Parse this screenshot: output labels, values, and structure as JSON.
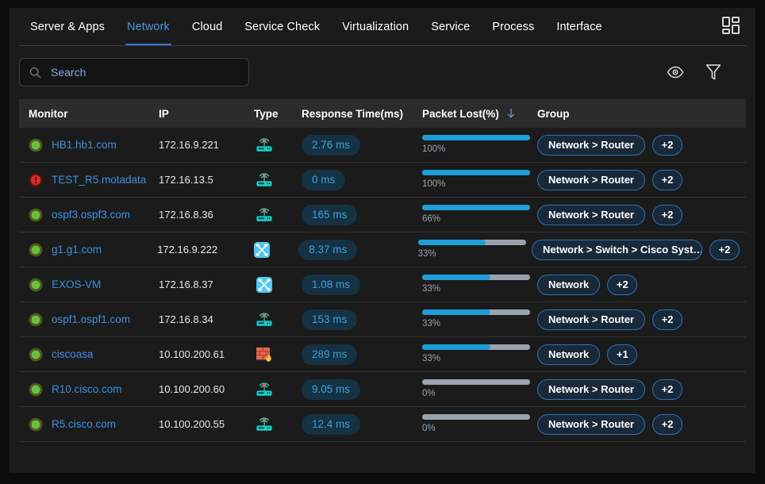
{
  "nav": {
    "tabs": [
      {
        "label": "Server & Apps",
        "active": false
      },
      {
        "label": "Network",
        "active": true
      },
      {
        "label": "Cloud",
        "active": false
      },
      {
        "label": "Service Check",
        "active": false
      },
      {
        "label": "Virtualization",
        "active": false
      },
      {
        "label": "Service",
        "active": false
      },
      {
        "label": "Process",
        "active": false
      },
      {
        "label": "Interface",
        "active": false
      }
    ],
    "dashboard_icon": "dashboard-grid-icon",
    "active_color": "#4d94e0",
    "active_underline_color": "#2e7cd6"
  },
  "toolbar": {
    "search": {
      "placeholder": "Search",
      "value": "",
      "icon": "search-icon"
    },
    "eye_icon": "eye-icon",
    "filter_icon": "filter-funnel-icon"
  },
  "table": {
    "columns": [
      {
        "key": "monitor",
        "label": "Monitor"
      },
      {
        "key": "ip",
        "label": "IP"
      },
      {
        "key": "type",
        "label": "Type"
      },
      {
        "key": "response",
        "label": "Response Time(ms)"
      },
      {
        "key": "packet",
        "label": "Packet Lost(%)",
        "sorted": true,
        "sort_direction": "desc",
        "sort_icon": "arrow-down-icon"
      },
      {
        "key": "group",
        "label": "Group"
      }
    ],
    "rows": [
      {
        "status": "ok",
        "status_icon": "status-ok-icon",
        "monitor": "HB1.hb1.com",
        "ip": "172.16.9.221",
        "type_icon": "router-icon",
        "response": "2.76 ms",
        "packet_pct": 100,
        "packet_label": "100%",
        "bar_fill_pct": 100,
        "group": "Network > Router",
        "group_more": "+2"
      },
      {
        "status": "critical",
        "status_icon": "status-critical-icon",
        "monitor": "TEST_R5.motadata",
        "ip": "172.16.13.5",
        "type_icon": "router-icon",
        "response": "0 ms",
        "packet_pct": 100,
        "packet_label": "100%",
        "bar_fill_pct": 100,
        "group": "Network > Router",
        "group_more": "+2"
      },
      {
        "status": "ok",
        "status_icon": "status-ok-icon",
        "monitor": "ospf3.ospf3.com",
        "ip": "172.16.8.36",
        "type_icon": "router-icon",
        "response": "165 ms",
        "packet_pct": 66,
        "packet_label": "66%",
        "bar_fill_pct": 100,
        "group": "Network > Router",
        "group_more": "+2"
      },
      {
        "status": "ok",
        "status_icon": "status-ok-icon",
        "monitor": "g1.g1.com",
        "ip": "172.16.9.222",
        "type_icon": "switch-icon",
        "response": "8.37 ms",
        "packet_pct": 33,
        "packet_label": "33%",
        "bar_fill_pct": 63,
        "group": "Network > Switch > Cisco Syst…",
        "group_more": "+2"
      },
      {
        "status": "ok",
        "status_icon": "status-ok-icon",
        "monitor": "EXOS-VM",
        "ip": "172.16.8.37",
        "type_icon": "switch-icon",
        "response": "1.08 ms",
        "packet_pct": 33,
        "packet_label": "33%",
        "bar_fill_pct": 63,
        "group": "Network",
        "group_more": "+2"
      },
      {
        "status": "ok",
        "status_icon": "status-ok-icon",
        "monitor": "ospf1.ospf1.com",
        "ip": "172.16.8.34",
        "type_icon": "router-icon",
        "response": "153 ms",
        "packet_pct": 33,
        "packet_label": "33%",
        "bar_fill_pct": 63,
        "group": "Network > Router",
        "group_more": "+2"
      },
      {
        "status": "ok",
        "status_icon": "status-ok-icon",
        "monitor": "ciscoasa",
        "ip": "10.100.200.61",
        "type_icon": "firewall-icon",
        "response": "289 ms",
        "packet_pct": 33,
        "packet_label": "33%",
        "bar_fill_pct": 63,
        "group": "Network",
        "group_more": "+1"
      },
      {
        "status": "ok",
        "status_icon": "status-ok-icon",
        "monitor": "R10.cisco.com",
        "ip": "10.100.200.60",
        "type_icon": "router-icon",
        "response": "9.05 ms",
        "packet_pct": 0,
        "packet_label": "0%",
        "bar_fill_pct": 0,
        "group": "Network > Router",
        "group_more": "+2"
      },
      {
        "status": "ok",
        "status_icon": "status-ok-icon",
        "monitor": "R5.cisco.com",
        "ip": "10.100.200.55",
        "type_icon": "router-icon",
        "response": "12.4 ms",
        "packet_pct": 0,
        "packet_label": "0%",
        "bar_fill_pct": 0,
        "group": "Network > Router",
        "group_more": "+2"
      }
    ]
  },
  "colors": {
    "page_background": "#0c0c0c",
    "panel_background": "#1b1b1b",
    "header_row": "#2b2b2b",
    "row_divider": "#333333",
    "link_blue": "#3d8fe0",
    "pill_blue_text": "#3d9fd8",
    "pill_blue_bg": "#143244",
    "bar_blue": "#1d9ed9",
    "bar_gray": "#9aa3ad",
    "badge_border": "#2f6fb5",
    "badge_bg": "#18293a",
    "status_ok": "#6abf3f",
    "status_critical": "#e03030"
  }
}
